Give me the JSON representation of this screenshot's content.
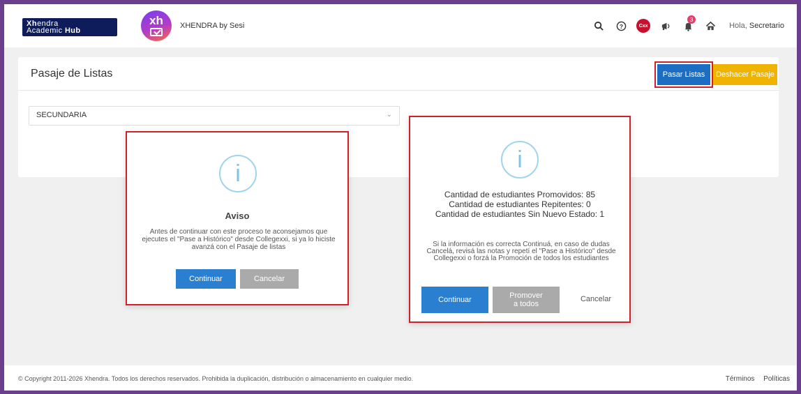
{
  "header": {
    "logo_line1_bold": "Xh",
    "logo_line1_rest": "endra",
    "logo_line2_rest": "Academic ",
    "logo_line2_bold": "Hub",
    "app_logo_text": "xh",
    "app_title": "XHENDRA by Sesi",
    "cxx_badge": "Cxx",
    "notification_count": "3",
    "greeting_prefix": "Hola, ",
    "user_name": "Secretario",
    "icons": [
      "search-icon",
      "help-icon",
      "cxx-badge",
      "megaphone-icon",
      "bell-icon",
      "home-icon"
    ]
  },
  "page": {
    "title": "Pasaje de Listas",
    "btn_pasar": "Pasar Listas",
    "btn_deshacer": "Deshacer Pasaje",
    "select_value": "SECUNDARIA"
  },
  "dialog_aviso": {
    "icon": "i",
    "title": "Aviso",
    "message": "Antes de continuar con este proceso te aconsejamos que ejecutes el \"Pase a Histórico\" desde Collegexxi, si ya lo hiciste avanzá con el Pasaje de listas",
    "btn_continue": "Continuar",
    "btn_cancel": "Cancelar"
  },
  "dialog_confirm": {
    "icon": "i",
    "stat_promovidos": "Cantidad de estudiantes Promovidos: 85",
    "stat_repitentes": "Cantidad de estudiantes Repitentes: 0",
    "stat_sin_estado": "Cantidad de estudiantes Sin Nuevo Estado: 1",
    "message": "Si la información es correcta Continuá, en caso de dudas Cancelá, revisá las notas y repetí el \"Pase a Histórico\" desde Collegexxi o forzá la Promoción de todos los estudiantes",
    "btn_continue": "Continuar",
    "btn_promover_1": "Promover",
    "btn_promover_2": "a todos",
    "btn_cancel": "Cancelar"
  },
  "footer": {
    "copyright": "© Copyright 2011-2026 Xhendra. Todos los derechos reservados. Prohibida la duplicación, distribución o almacenamiento en cualquier medio.",
    "terms": "Términos",
    "policies": "Políticas"
  },
  "colors": {
    "primary": "#1b6ec2",
    "warning": "#f0b400",
    "highlight": "#d0212a",
    "info": "#7cc5e3"
  }
}
